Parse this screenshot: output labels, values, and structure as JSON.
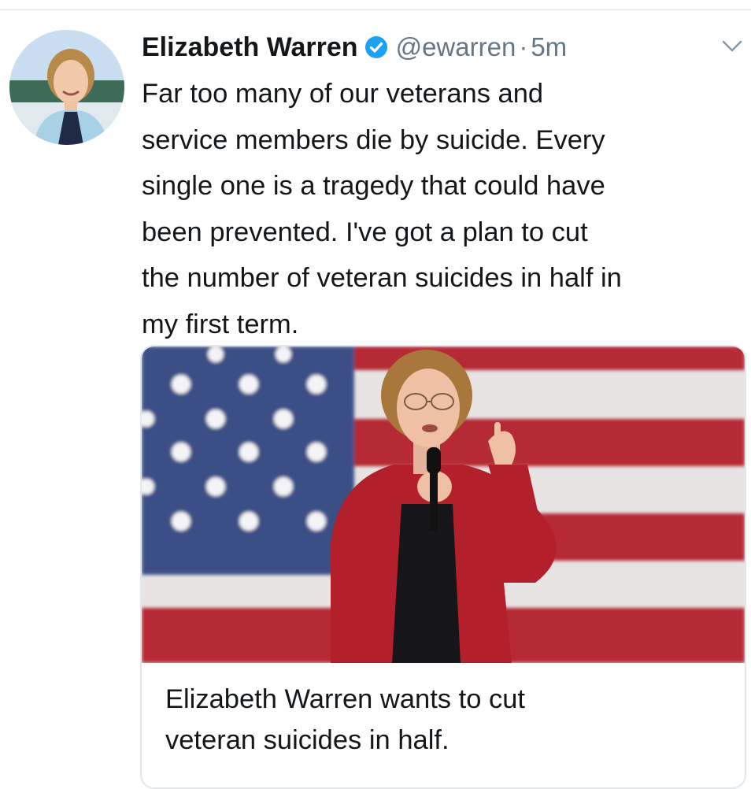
{
  "tweet": {
    "display_name": "Elizabeth Warren",
    "verified": true,
    "handle": "@ewarren",
    "separator": "·",
    "timestamp": "5m",
    "text_lines": [
      "Far too many of our veterans and",
      "service members die by suicide. Every",
      "single one is a tragedy that could have",
      "been prevented. I've got a plan to cut",
      "the number of veteran suicides in half in",
      "my first term."
    ]
  },
  "card": {
    "title_lines": [
      "Elizabeth Warren wants to cut",
      "veteran suicides in half."
    ]
  },
  "icons": {
    "avatar": "profile-photo",
    "verified": "verified-badge-icon",
    "menu": "chevron-down-icon",
    "card_image": "american-flag-photo"
  },
  "colors": {
    "verified_blue": "#1da1f2",
    "secondary_text": "#657786",
    "primary_text": "#14171a",
    "flag_blue": "#3a4f86",
    "flag_red": "#b52b35",
    "jacket_red": "#b3202b"
  }
}
